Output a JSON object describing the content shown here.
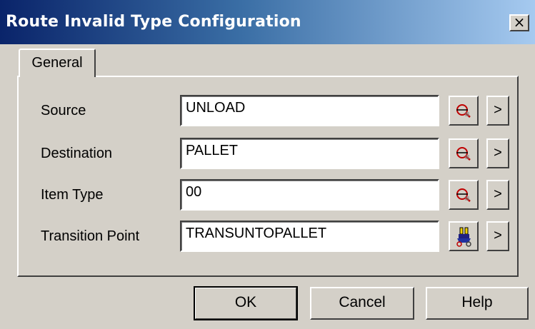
{
  "window": {
    "title": "Route Invalid Type Configuration",
    "close_label": "×"
  },
  "tabs": [
    {
      "label": "General"
    }
  ],
  "rows": [
    {
      "label": "Source",
      "value": "UNLOAD",
      "icon": "lookup-icon",
      "arrow": ">"
    },
    {
      "label": "Destination",
      "value": "PALLET",
      "icon": "lookup-icon",
      "arrow": ">"
    },
    {
      "label": "Item Type",
      "value": "00",
      "icon": "lookup-icon",
      "arrow": ">"
    },
    {
      "label": "Transition Point",
      "value": "TRANSUNTOPALLET",
      "icon": "transition-point-icon",
      "arrow": ">"
    }
  ],
  "buttons": {
    "ok": "OK",
    "cancel": "Cancel",
    "help": "Help"
  },
  "colors": {
    "title_start": "#0a246a",
    "title_end": "#a6caf0",
    "face": "#d4d0c8"
  }
}
